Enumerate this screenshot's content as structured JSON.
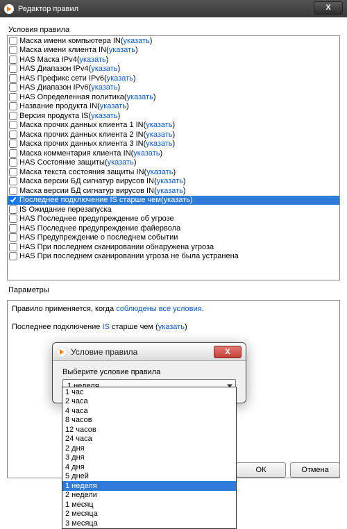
{
  "outerWindow": {
    "title": "Редактор правил",
    "close": "X"
  },
  "conditionsLabel": "Условия правила",
  "conditions": [
    {
      "text": "Маска имени компьютера IN",
      "link": "указать",
      "checked": false,
      "selected": false
    },
    {
      "text": "Маска имени клиента IN",
      "link": "указать",
      "checked": false,
      "selected": false
    },
    {
      "text": "HAS Маска IPv4",
      "link": "указать",
      "checked": false,
      "selected": false
    },
    {
      "text": "HAS Диапазон IPv4",
      "link": "указать",
      "checked": false,
      "selected": false
    },
    {
      "text": "HAS Префикс сети IPv6",
      "link": "указать",
      "checked": false,
      "selected": false
    },
    {
      "text": "HAS Диапазон IPv6",
      "link": "указать",
      "checked": false,
      "selected": false
    },
    {
      "text": "HAS Определенная политика",
      "link": "указать",
      "checked": false,
      "selected": false
    },
    {
      "text": "Название продукта IN",
      "link": "указать",
      "checked": false,
      "selected": false
    },
    {
      "text": "Версия продукта IS",
      "link": "указать",
      "checked": false,
      "selected": false
    },
    {
      "text": "Маска прочих данных клиента 1 IN",
      "link": "указать",
      "checked": false,
      "selected": false
    },
    {
      "text": "Маска прочих данных клиента 2 IN",
      "link": "указать",
      "checked": false,
      "selected": false
    },
    {
      "text": "Маска прочих данных клиента 3 IN",
      "link": "указать",
      "checked": false,
      "selected": false
    },
    {
      "text": "Маска комментария клиента IN",
      "link": "указать",
      "checked": false,
      "selected": false
    },
    {
      "text": "HAS Состояние защиты",
      "link": "указать",
      "checked": false,
      "selected": false
    },
    {
      "text": "Маска текста состояния защиты IN",
      "link": "указать",
      "checked": false,
      "selected": false
    },
    {
      "text": "Маска версии БД сигнатур вирусов IN",
      "link": "указать",
      "checked": false,
      "selected": false
    },
    {
      "text": "Маска версии БД сигнатур вирусов IN",
      "link": "указать",
      "checked": false,
      "selected": false
    },
    {
      "text": "Последнее подключение IS старше чем",
      "link": "указать",
      "checked": true,
      "selected": true
    },
    {
      "text": "IS Ожидание перезапуска",
      "link": "",
      "checked": false,
      "selected": false
    },
    {
      "text": "HAS Последнее предупреждение об угрозе",
      "link": "",
      "checked": false,
      "selected": false
    },
    {
      "text": "HAS Последнее предупреждение файервола",
      "link": "",
      "checked": false,
      "selected": false
    },
    {
      "text": "HAS Предупреждение о последнем событии",
      "link": "",
      "checked": false,
      "selected": false
    },
    {
      "text": "HAS При последнем сканировании обнаружена угроза",
      "link": "",
      "checked": false,
      "selected": false
    },
    {
      "text": "HAS При последнем сканировании угроза не была устранена",
      "link": "",
      "checked": false,
      "selected": false
    }
  ],
  "parametersLabel": "Параметры",
  "sentence1_pre": "Правило применяется, когда ",
  "sentence1_link": "соблюдены все условия",
  "sentence1_post": ".",
  "sentence2_pre": "Последнее подключение ",
  "sentence2_mid1": "IS",
  "sentence2_mid2": " старше чем ",
  "sentence2_link": "указать",
  "buttons": {
    "ok": "ОК",
    "cancel": "Отмена"
  },
  "dialog": {
    "title": "Условие правила",
    "close": "X",
    "label": "Выберите условие правила",
    "selectValue": "1 неделя"
  },
  "dropdown": {
    "items": [
      {
        "label": "1 час",
        "hl": false
      },
      {
        "label": "2 часа",
        "hl": false
      },
      {
        "label": "4 часа",
        "hl": false
      },
      {
        "label": "8 часов",
        "hl": false
      },
      {
        "label": "12 часов",
        "hl": false
      },
      {
        "label": "24 часа",
        "hl": false
      },
      {
        "label": "2 дня",
        "hl": false
      },
      {
        "label": "3 дня",
        "hl": false
      },
      {
        "label": "4 дня",
        "hl": false
      },
      {
        "label": "5 дней",
        "hl": false
      },
      {
        "label": "1 неделя",
        "hl": true
      },
      {
        "label": "2 недели",
        "hl": false
      },
      {
        "label": "1 месяц",
        "hl": false
      },
      {
        "label": "2 месяца",
        "hl": false
      },
      {
        "label": "3 месяца",
        "hl": false
      }
    ]
  }
}
